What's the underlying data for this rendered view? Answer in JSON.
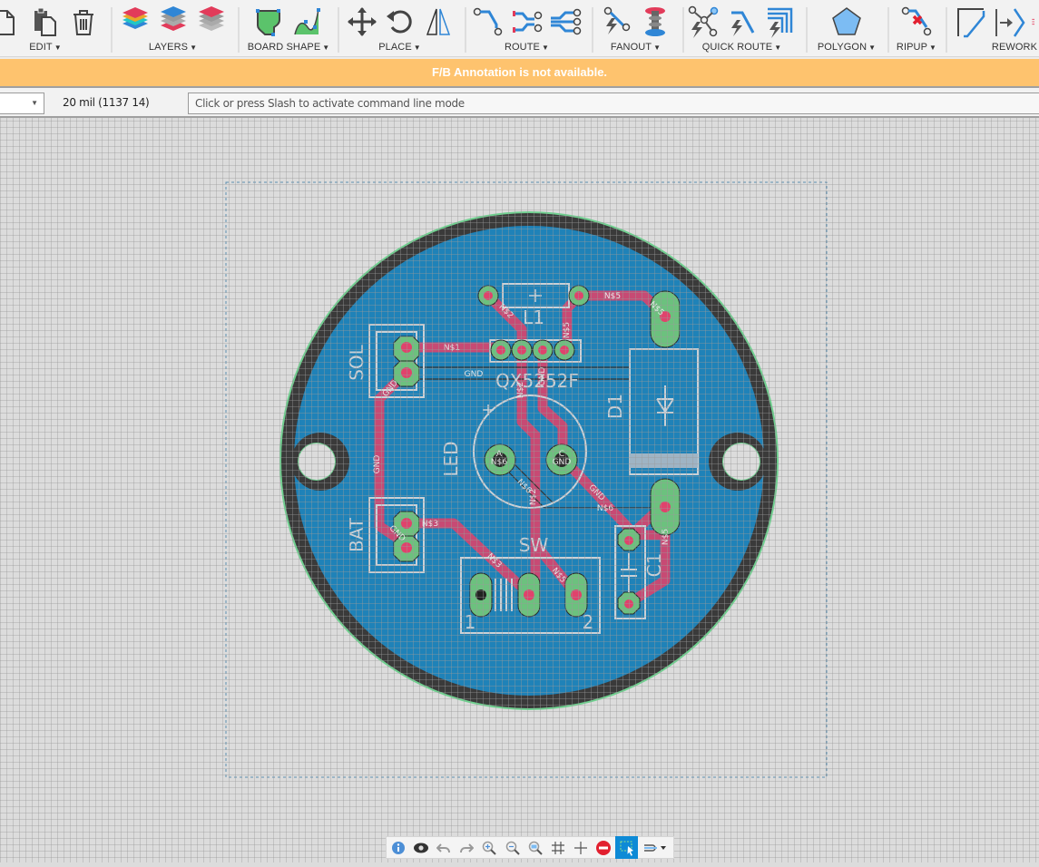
{
  "toolbar": {
    "groups": [
      {
        "id": "edit",
        "label": "EDIT",
        "icons": [
          "new-file-icon",
          "paste-icon",
          "delete-icon"
        ]
      },
      {
        "id": "layers",
        "label": "LAYERS",
        "icons": [
          "layers-all-icon",
          "layers-top-icon",
          "layers-bottom-icon"
        ]
      },
      {
        "id": "board-shape",
        "label": "BOARD SHAPE",
        "icons": [
          "board-outline-icon",
          "board-curve-icon"
        ]
      },
      {
        "id": "place",
        "label": "PLACE",
        "icons": [
          "move-icon",
          "rotate-icon",
          "mirror-icon"
        ]
      },
      {
        "id": "route",
        "label": "ROUTE",
        "icons": [
          "route-single-icon",
          "route-diff-pair-icon",
          "route-multi-icon"
        ]
      },
      {
        "id": "fanout",
        "label": "FANOUT",
        "icons": [
          "fanout-icon",
          "via-stack-icon"
        ]
      },
      {
        "id": "quick-route",
        "label": "QUICK ROUTE",
        "icons": [
          "quick-route-icon",
          "quick-route-single-icon",
          "quick-route-bus-icon"
        ]
      },
      {
        "id": "polygon",
        "label": "POLYGON",
        "icons": [
          "polygon-icon"
        ]
      },
      {
        "id": "ripup",
        "label": "RIPUP",
        "icons": [
          "ripup-icon"
        ]
      },
      {
        "id": "rework",
        "label": "REWORK",
        "icons": [
          "rework-miter-icon",
          "rework-slide-icon",
          "rework-more-icon"
        ]
      }
    ]
  },
  "banner": {
    "text": "F/B Annotation is not available.",
    "color": "#fec36e"
  },
  "cmdbar": {
    "layer_value": "",
    "grid_readout": "20 mil (1137 14)",
    "command_placeholder": "Click or press Slash to activate command line mode"
  },
  "board": {
    "colors": {
      "background": "#dcdcdc",
      "grid": "#9a9a9a",
      "copper_pour": "#1f82b8",
      "keepout": "#3a3a3a",
      "outline": "#6fd08f",
      "trace_top": "#d6466f",
      "pad": "#6cc17e",
      "silkscreen": "#c9d0d6"
    },
    "components": [
      {
        "ref": "SOL",
        "type": "connector-2pin"
      },
      {
        "ref": "BAT",
        "type": "connector-2pin"
      },
      {
        "ref": "L1",
        "type": "inductor"
      },
      {
        "ref": "QX5252F",
        "type": "ic-4pin"
      },
      {
        "ref": "LED",
        "type": "led",
        "pins": [
          "A",
          "C"
        ]
      },
      {
        "ref": "D1",
        "type": "diode"
      },
      {
        "ref": "SW",
        "type": "switch",
        "pins": [
          "1",
          "2"
        ]
      },
      {
        "ref": "C1",
        "type": "capacitor"
      }
    ],
    "net_labels": [
      "N$1",
      "GND",
      "GND",
      "N$2",
      "N$5",
      "N$5",
      "N$5",
      "N$2",
      "GND",
      "N$6",
      "N$6",
      "GND",
      "N$6",
      "N$3",
      "N$3",
      "N$2",
      "N$5",
      "N$5",
      "GND",
      "N$2"
    ],
    "text": {
      "sol": "SOL",
      "bat": "BAT",
      "l1": "L1",
      "ic": "QX5252F",
      "led": "LED",
      "d1": "D1",
      "sw": "SW",
      "c1": "C1",
      "sw_pin1": "1",
      "sw_pin2": "2",
      "led_a": "A",
      "led_c": "C",
      "n1": "N$1",
      "gnd_sol": "GND",
      "gnd_h": "GND",
      "gnd_ic": "GND",
      "gnd_led": "GND",
      "gnd_vert": "GND",
      "gnd_bat": "GND",
      "gnd_diag": "GND",
      "n2a": "N$2",
      "n2b": "N$2",
      "n2c": "N$2",
      "n5a": "N$5",
      "n5b": "N$5",
      "n5c": "N$5",
      "n5d": "N$5",
      "n5e": "N$5",
      "n6a": "N$6",
      "n6b": "N$6",
      "n6c": "N$6",
      "n3a": "N$3",
      "n3b": "N$3"
    }
  },
  "bottombar": {
    "buttons": [
      {
        "name": "info-icon"
      },
      {
        "name": "visibility-icon"
      },
      {
        "name": "undo-icon"
      },
      {
        "name": "redo-icon"
      },
      {
        "name": "zoom-in-icon"
      },
      {
        "name": "zoom-out-icon"
      },
      {
        "name": "zoom-fit-icon"
      },
      {
        "name": "grid-icon"
      },
      {
        "name": "crosshair-icon"
      },
      {
        "name": "stop-icon"
      },
      {
        "name": "select-icon",
        "active": true
      },
      {
        "name": "route-mode-icon"
      }
    ]
  }
}
